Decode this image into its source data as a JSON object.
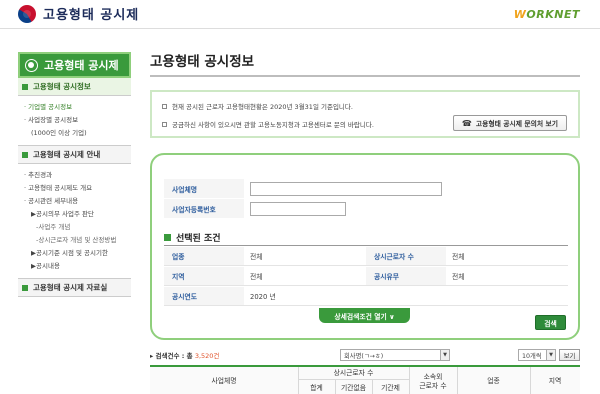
{
  "header": {
    "site_title": "고용형태 공시제",
    "partner_logo": "WORKNET",
    "partner_logo_w": "W",
    "partner_logo_rest": "ORKNET"
  },
  "sidebar": {
    "title": "고용형태 공시제",
    "section1": "고용형태 공시정보",
    "section1_items": [
      "기업별 공시정보",
      "사업장별 공시정보",
      "(1000인 이상 기업)"
    ],
    "section2": "고용형태 공시제 안내",
    "section2_items": [
      "추진경과",
      "고용형태 공시제도 개요",
      "공시관련 세부내용",
      "▶공시의무 사업주 판단",
      "-사업주 개념",
      "-상시근로자 개념 및 산정방법",
      "▶공시기준 시점 및 공시기한",
      "▶공시내용"
    ],
    "section3": "고용형태 공시제 자료실"
  },
  "main": {
    "page_title": "고용형태 공시정보",
    "notice": {
      "line1": "현재 공시된 근로자 고용형태현황은 2020년 3월31일 기준입니다.",
      "line2": "궁금하신 사항이 있으시면 관할 고용노동지청과 고용센터로 문의 바랍니다.",
      "contact_button": "고용형태 공시제 문의처 보기"
    },
    "search": {
      "company_label": "사업체명",
      "company_value": "",
      "regno_label": "사업자등록번호",
      "regno_value": "",
      "selected_title": "선택된 조건",
      "conditions": {
        "industry_label": "업종",
        "industry_value": "전체",
        "workers_label": "상시근로자 수",
        "workers_value": "전체",
        "region_label": "지역",
        "region_value": "전체",
        "type_label": "공시유무",
        "type_value": "전체",
        "year_label": "공시연도",
        "year_value": "2020 년"
      },
      "detail_button": "상세검색조건 열기 ∨",
      "search_button": "검색"
    },
    "results": {
      "count_label": "검색건수 : 총",
      "count_value": "3,520건",
      "sort_select": "회사명(ㄱ→ㅎ)",
      "page_size_select": "10개씩",
      "view_button": "보기",
      "columns": {
        "company": "사업체명",
        "workers_group": "상시근로자 수",
        "total": "합계",
        "unlimited": "기간없음",
        "limited": "기간제",
        "outside": "소속외\n근로자 수",
        "industry": "업종",
        "region": "지역"
      }
    }
  },
  "colors": {
    "brand_green": "#3a9a3c",
    "light_green_border": "#8fcf7c",
    "label_blue": "#2f5e9e",
    "count_orange": "#e0522a"
  }
}
